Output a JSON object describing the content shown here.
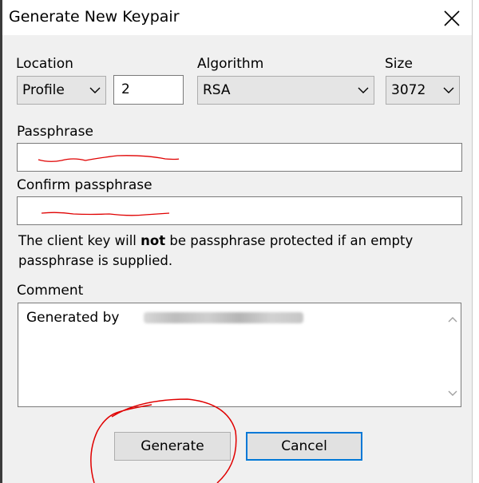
{
  "window": {
    "title": "Generate New Keypair"
  },
  "location": {
    "label": "Location",
    "selected": "Profile",
    "number": "2"
  },
  "algorithm": {
    "label": "Algorithm",
    "selected": "RSA"
  },
  "size": {
    "label": "Size",
    "selected": "3072"
  },
  "passphrase": {
    "label": "Passphrase"
  },
  "confirm": {
    "label": "Confirm passphrase"
  },
  "note": {
    "part1": "The client key will ",
    "bold": "not",
    "part2": " be passphrase protected if an empty passphrase is supplied."
  },
  "comment": {
    "label": "Comment",
    "value": "Generated by"
  },
  "buttons": {
    "generate": "Generate",
    "cancel": "Cancel"
  },
  "icons": {
    "close": "close-icon",
    "chevron": "chevron-down-icon",
    "scroll_up": "scroll-up-icon",
    "scroll_down": "scroll-down-icon"
  },
  "colors": {
    "accent": "#0078d7",
    "annotation": "#e00000",
    "dialog_bg": "#f0f0f0"
  }
}
